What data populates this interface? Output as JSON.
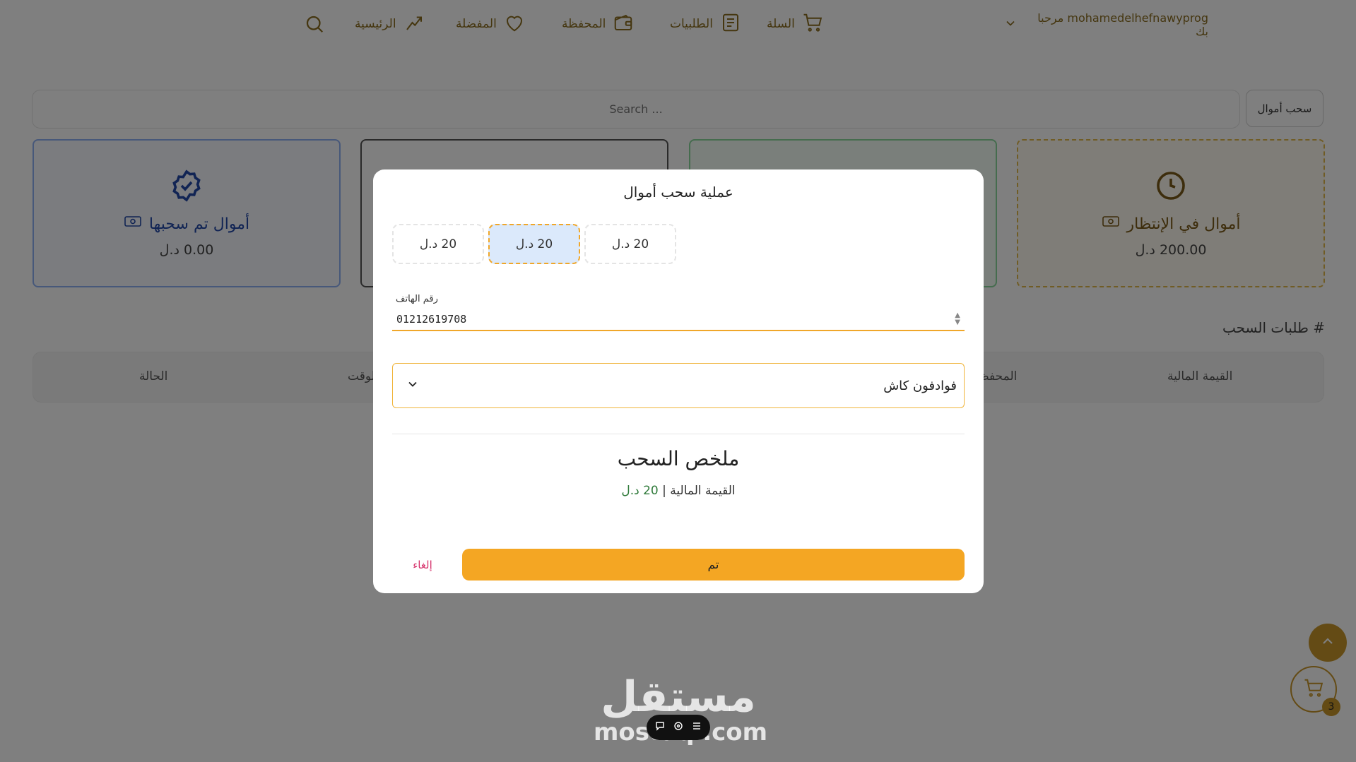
{
  "nav": {
    "greeting": "mohamedelhefnawyprog مرحبا بك",
    "cart": "السلة",
    "orders": "الطلبيات",
    "wallet": "المحفظة",
    "favorites": "المفضلة",
    "home": "الرئيسية"
  },
  "search": {
    "placeholder": "Search ..."
  },
  "withdraw_button": "سحب أموال",
  "cards": {
    "pending": {
      "title": "أموال في الإنتظار",
      "amount": "200.00 د.ل"
    },
    "withdrawn": {
      "title": "أموال تم سحبها",
      "amount": "0.00 د.ل"
    }
  },
  "requests": {
    "title": "# طلبات السحب",
    "columns": {
      "amount": "القيمة المالية",
      "wallet": "المحفظة",
      "time": "الوقت",
      "status": "الحالة"
    }
  },
  "modal": {
    "title": "عملية سحب أموال",
    "amount_options": [
      "20 د.ل",
      "20 د.ل",
      "20 د.ل"
    ],
    "selected_index": 1,
    "phone_label": "رقم الهاتف",
    "phone_value": "01212619708",
    "method_value": "فوادفون كاش",
    "summary_title": "ملخص السحب",
    "summary_label": "القيمة المالية |",
    "summary_value": "20 د.ل",
    "confirm": "تم",
    "cancel": "إلغاء"
  },
  "floating": {
    "cart_count": "3"
  },
  "watermark": {
    "arabic": "مستقل",
    "latin": "mostaql.com"
  },
  "colors": {
    "accent": "#f4a623",
    "brand_gold": "#c8962a",
    "cancel": "#d6336c",
    "selected_bg": "#dbe9fb"
  }
}
